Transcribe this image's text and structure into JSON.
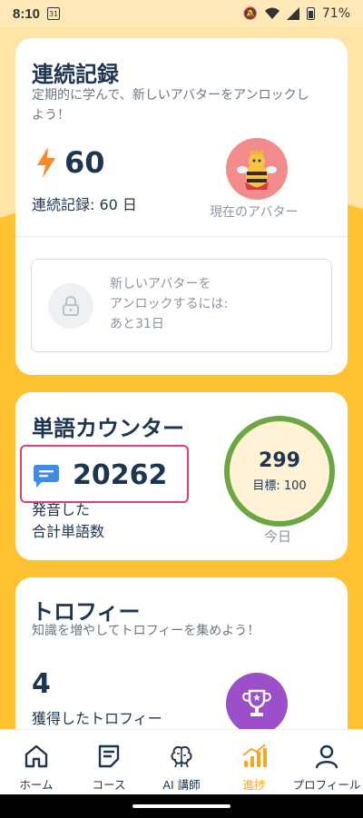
{
  "status": {
    "time": "8:10",
    "calendar_day": "31",
    "battery": "71%"
  },
  "streak_card": {
    "title": "連続記録",
    "subtitle_line1": "定期的に学んで、新しいアバターをアンロックし",
    "subtitle_line2": "よう！",
    "streak_number": "60",
    "streak_label": "連続記録: 60 日",
    "avatar_caption": "現在のアバター",
    "unlock_line1": "新しいアバターを",
    "unlock_line2": "アンロックするには:",
    "unlock_line3": "あと31日"
  },
  "word_card": {
    "title": "単語カウンター",
    "count": "20262",
    "label_line1": "発音した",
    "label_line2": "合計単語数",
    "today_count": "299",
    "goal": "目標: 100",
    "today_label": "今日",
    "ring_color": "#6BA843",
    "highlight_color": "#E63B73"
  },
  "trophy_card": {
    "title": "トロフィー",
    "subtitle": "知識を増やしてトロフィーを集めよう！",
    "count": "4",
    "label": "獲得したトロフィー"
  },
  "nav": {
    "items": [
      {
        "label": "ホーム",
        "icon": "home-icon"
      },
      {
        "label": "コース",
        "icon": "course-icon"
      },
      {
        "label": "AI 講師",
        "icon": "brain-icon"
      },
      {
        "label": "進捗",
        "icon": "progress-chart-icon"
      },
      {
        "label": "プロフィール",
        "icon": "profile-icon"
      }
    ],
    "active_index": 3,
    "active_color": "#F5A623"
  }
}
